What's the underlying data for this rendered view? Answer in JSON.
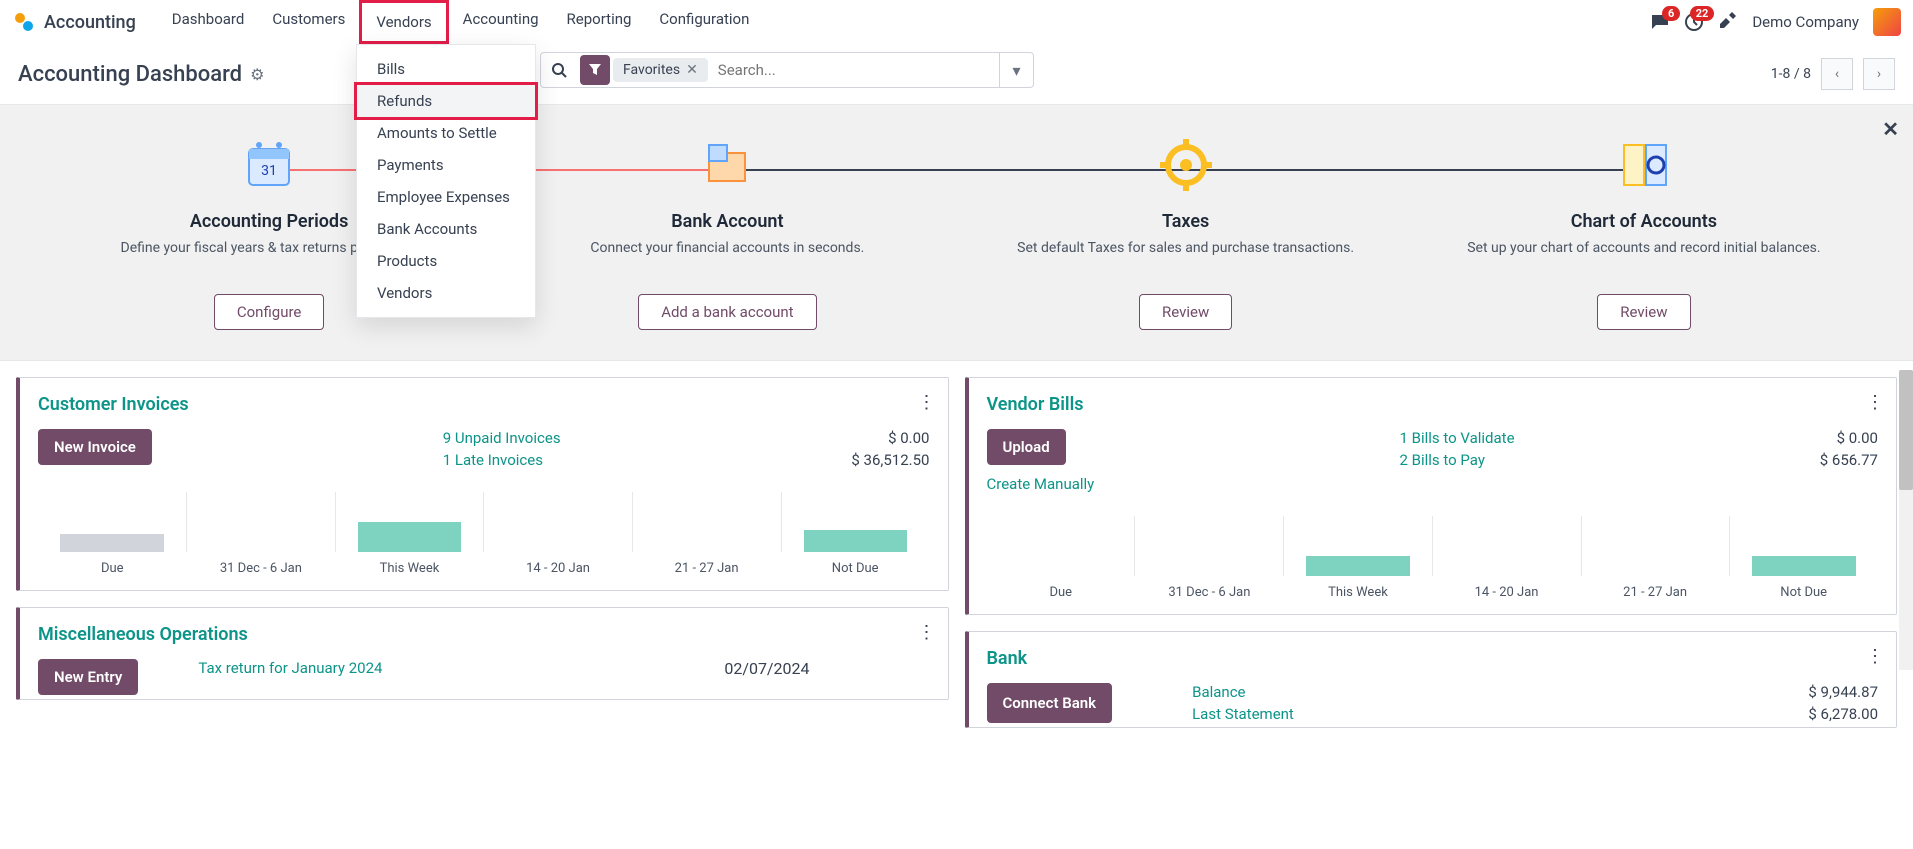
{
  "nav": {
    "app": "Accounting",
    "items": [
      "Dashboard",
      "Customers",
      "Vendors",
      "Accounting",
      "Reporting",
      "Configuration"
    ],
    "msg_badge": "6",
    "clock_badge": "22",
    "company": "Demo Company"
  },
  "dropdown": [
    "Bills",
    "Refunds",
    "Amounts to Settle",
    "Payments",
    "Employee Expenses",
    "Bank Accounts",
    "Products",
    "Vendors"
  ],
  "page_title": "Accounting Dashboard",
  "search": {
    "chip": "Favorites",
    "placeholder": "Search..."
  },
  "pager": "1-8 / 8",
  "banner": {
    "steps": [
      {
        "title": "Accounting Periods",
        "desc": "Define your fiscal years & tax returns periodicity.",
        "btn": "Configure"
      },
      {
        "title": "Bank Account",
        "desc": "Connect your financial accounts in seconds.",
        "btn": "Add a bank account"
      },
      {
        "title": "Taxes",
        "desc": "Set default Taxes for sales and purchase transactions.",
        "btn": "Review"
      },
      {
        "title": "Chart of Accounts",
        "desc": "Set up your chart of accounts and record initial balances.",
        "btn": "Review"
      }
    ]
  },
  "cards": {
    "ci": {
      "title": "Customer Invoices",
      "btn": "New Invoice",
      "link1": "9 Unpaid Invoices",
      "amt1": "$ 0.00",
      "link2": "1 Late Invoices",
      "amt2": "$ 36,512.50",
      "labels": [
        "Due",
        "31 Dec - 6 Jan",
        "This Week",
        "14 - 20 Jan",
        "21 - 27 Jan",
        "Not Due"
      ]
    },
    "vb": {
      "title": "Vendor Bills",
      "btn": "Upload",
      "create": "Create Manually",
      "link1": "1 Bills to Validate",
      "amt1": "$ 0.00",
      "link2": "2 Bills to Pay",
      "amt2": "$ 656.77",
      "labels": [
        "Due",
        "31 Dec - 6 Jan",
        "This Week",
        "14 - 20 Jan",
        "21 - 27 Jan",
        "Not Due"
      ]
    },
    "mo": {
      "title": "Miscellaneous Operations",
      "btn": "New Entry",
      "link": "Tax return for January 2024",
      "date": "02/07/2024"
    },
    "bank": {
      "title": "Bank",
      "btn": "Connect Bank",
      "l1": "Balance",
      "a1": "$ 9,944.87",
      "l2": "Last Statement",
      "a2": "$ 6,278.00"
    }
  }
}
